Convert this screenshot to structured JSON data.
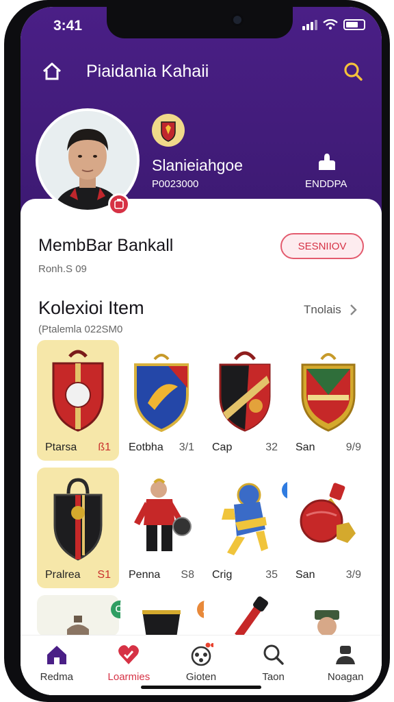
{
  "status_bar": {
    "time": "3:41"
  },
  "header": {
    "title": "Piaidania Kahaii",
    "home_icon": "home-icon",
    "search_icon": "search-icon"
  },
  "profile": {
    "name": "Slanieiahgoe",
    "code": "P0023000",
    "edit_label": "ENDDPA"
  },
  "member": {
    "title": "MembBar Bankall",
    "subtitle": "Ronh.S 09",
    "status_pill": "SESNIIOV"
  },
  "collection": {
    "title": "Kolexioi Item",
    "subtitle": "(Ptalemla 022SM0",
    "see_all": "Tnolais",
    "items": [
      {
        "name": "Ptarsa",
        "num": "ß1",
        "highlight": true,
        "icon": "shield-red-icon"
      },
      {
        "name": "Eotbha",
        "num": "3/1",
        "highlight": false,
        "icon": "shield-blue-icon"
      },
      {
        "name": "Cap",
        "num": "32",
        "highlight": false,
        "icon": "shield-black-icon"
      },
      {
        "name": "San",
        "num": "9/9",
        "highlight": false,
        "icon": "shield-crest-icon"
      },
      {
        "name": "Pralrea",
        "num": "S1",
        "highlight": true,
        "icon": "black-shield-icon"
      },
      {
        "name": "Penna",
        "num": "S8",
        "highlight": false,
        "icon": "player-figure-icon"
      },
      {
        "name": "Crig",
        "num": "35",
        "highlight": false,
        "icon": "astronaut-figure-icon"
      },
      {
        "name": "San",
        "num": "3/9",
        "highlight": false,
        "icon": "ball-charm-icon"
      }
    ],
    "badge_count": "1"
  },
  "tabs": [
    {
      "label": "Redma",
      "icon": "house-icon",
      "active": false
    },
    {
      "label": "Loarmies",
      "icon": "heart-icon",
      "active": true
    },
    {
      "label": "Gioten",
      "icon": "game-controller-icon",
      "active": false
    },
    {
      "label": "Taon",
      "icon": "magnifier-icon",
      "active": false
    },
    {
      "label": "Noagan",
      "icon": "user-icon",
      "active": false
    }
  ],
  "colors": {
    "header_bg": "#4a1f86",
    "accent_red": "#d63245",
    "highlight_card": "#f6e7a9"
  }
}
